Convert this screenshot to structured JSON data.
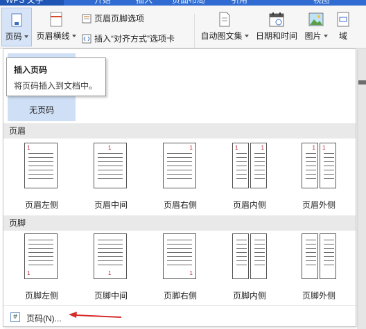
{
  "title_bar": {
    "app_name": "WPS 文字",
    "tabs": [
      "开始",
      "插入",
      "页面布局",
      "引用",
      "视图"
    ]
  },
  "ribbon": {
    "page_number_btn": "页码",
    "header_line_btn": "页眉横线",
    "header_footer_options": "页眉页脚选项",
    "insert_align_tab": "插入“对齐方式”选项卡",
    "auto_text_btn": "自动图文集",
    "date_time_btn": "日期和时间",
    "picture_btn": "图片",
    "field_btn": "域"
  },
  "tooltip": {
    "title": "插入页码",
    "description": "将页码插入到文档中。"
  },
  "panel": {
    "none_label": "无页码",
    "header_section": "页眉",
    "footer_section": "页脚",
    "page_number_sample": "1",
    "header_items": [
      "页眉左侧",
      "页眉中间",
      "页眉右侧",
      "页眉内侧",
      "页眉外侧"
    ],
    "footer_items": [
      "页脚左侧",
      "页脚中间",
      "页脚右侧",
      "页脚内侧",
      "页脚外侧"
    ],
    "more_option": "页码(N)..."
  },
  "colors": {
    "title_blue": "#2f6bd0",
    "selected_bg": "#cfdff5",
    "section_bg": "#e9e9e9",
    "arrow_red": "#d62a2a",
    "page_number_red": "#b23333"
  }
}
